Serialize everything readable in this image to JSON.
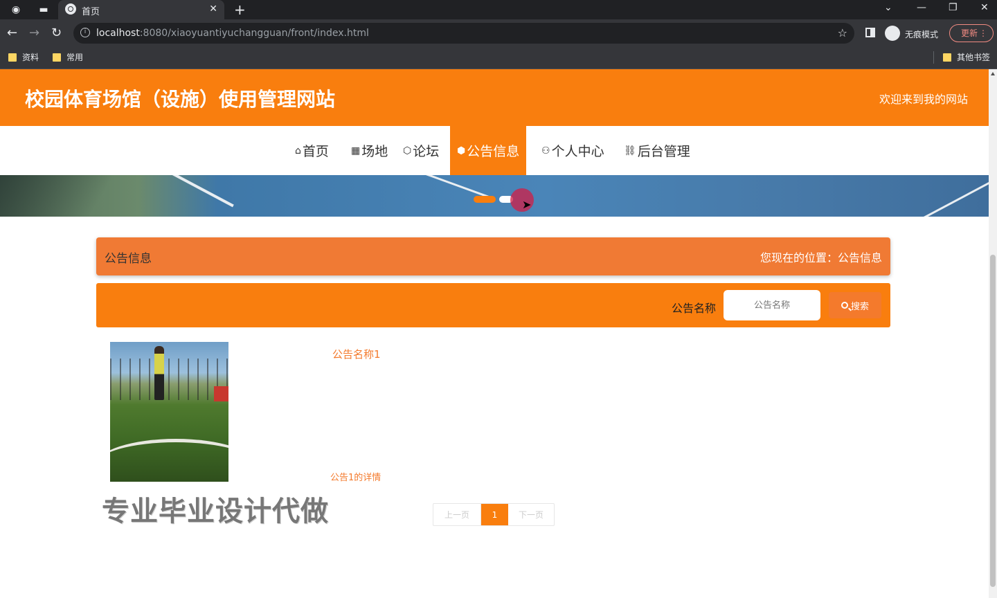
{
  "browser": {
    "tab_title": "首页",
    "url_host": "localhost",
    "url_path": ":8080/xiaoyuantiyuchangguan/front/index.html",
    "incognito_label": "无痕模式",
    "update_label": "更新",
    "bookmarks": [
      "资料",
      "常用"
    ],
    "other_bookmarks": "其他书签"
  },
  "site": {
    "title": "校园体育场馆（设施）使用管理网站",
    "welcome": "欢迎来到我的网站"
  },
  "nav": [
    {
      "icon": "⌂",
      "label": "首页"
    },
    {
      "icon": "▦",
      "label": "场地"
    },
    {
      "icon": "⬡",
      "label": "论坛"
    },
    {
      "icon": "⬢",
      "label": "公告信息"
    },
    {
      "icon": "⚇",
      "label": "个人中心"
    },
    {
      "icon": "⛓",
      "label": "后台管理"
    }
  ],
  "breadcrumb": {
    "title": "公告信息",
    "location": "您现在的位置：公告信息"
  },
  "search": {
    "label": "公告名称",
    "placeholder": "公告名称",
    "button": "搜索"
  },
  "news": [
    {
      "title": "公告名称1",
      "detail": "公告1的详情"
    }
  ],
  "watermark": "专业毕业设计代做",
  "pager": {
    "prev": "上一页",
    "current": "1",
    "next": "下一页"
  }
}
